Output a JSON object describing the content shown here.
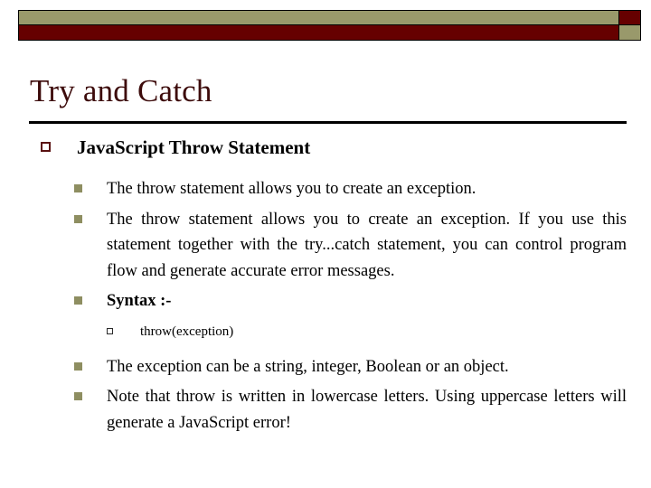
{
  "slide": {
    "title": "Try and Catch",
    "header_decoration": {
      "olive_color": "#99996b",
      "red_color": "#660000",
      "border_color": "#000000"
    },
    "title_color": "#3d0b0b",
    "rule_color": "#000000"
  },
  "bullets": {
    "level1": {
      "marker": "hollow-square-bullet",
      "marker_color": "#5a1111",
      "text": "JavaScript Throw Statement"
    },
    "level2": {
      "marker": "filled-square-bullet",
      "marker_color": "#8e8e61",
      "items": [
        "The throw statement allows you to create an exception.",
        "The throw statement allows you to create an exception. If you use this statement together with the try...catch statement, you can control program flow and generate accurate error messages.",
        "Syntax :-",
        "The exception can be a string, integer, Boolean or an object.",
        "Note that throw is written in lowercase letters. Using uppercase letters will generate a JavaScript error!"
      ]
    },
    "level3": {
      "marker": "small-hollow-square-bullet",
      "marker_color": "#2a2a2a",
      "items": [
        "throw(exception)"
      ]
    }
  }
}
